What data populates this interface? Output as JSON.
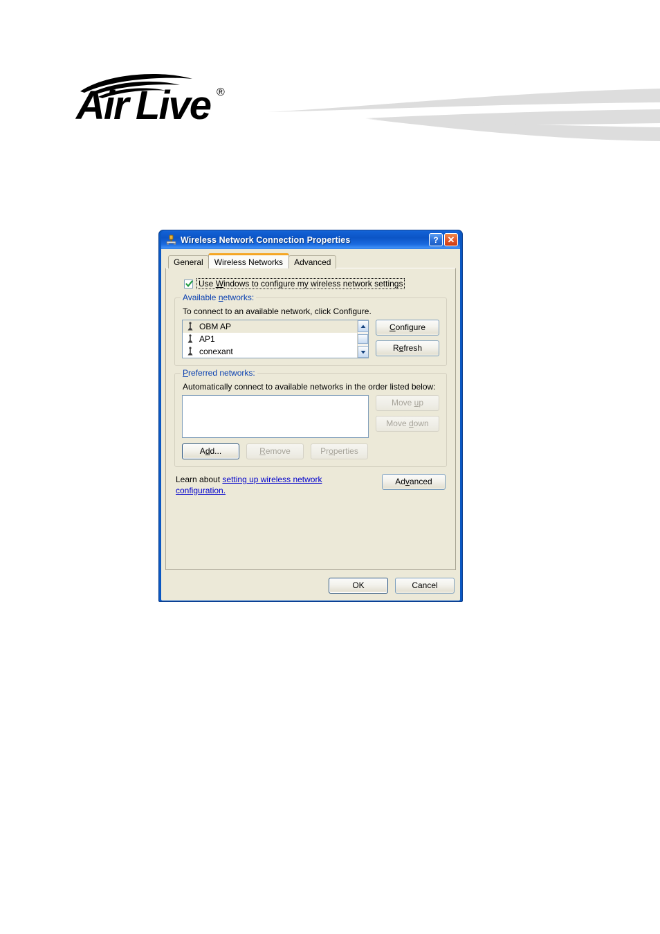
{
  "branding": {
    "logo_text": "Air Live",
    "logo_trademark": "®",
    "swoosh": "decorative-swoosh"
  },
  "dialog": {
    "title": "Wireless Network Connection Properties",
    "titlebar_icon": "network-connection-icon",
    "help_button": "?",
    "close_button": "✕",
    "tabs": [
      {
        "label": "General",
        "active": false
      },
      {
        "label": "Wireless Networks",
        "active": true
      },
      {
        "label": "Advanced",
        "active": false
      }
    ],
    "use_windows_checkbox": {
      "checked": true,
      "label_pre": "U",
      "label_accel": "W",
      "label_full": "Use Windows to configure my wireless network settings",
      "part1": "Use ",
      "part2": "indows to configure my wireless network settings"
    },
    "available_networks": {
      "title_part1": "Available ",
      "title_accel": "n",
      "title_part2": "etworks:",
      "hint": "To connect to an available network, click Configure.",
      "items": [
        {
          "name": "OBM AP",
          "icon": "wireless-network-icon",
          "selected": true
        },
        {
          "name": "AP1",
          "icon": "wireless-network-icon",
          "selected": false
        },
        {
          "name": "conexant",
          "icon": "wireless-network-icon",
          "selected": false
        }
      ],
      "configure_button": {
        "pre": "",
        "accel": "C",
        "post": "onfigure",
        "enabled": true
      },
      "refresh_button": {
        "pre": "R",
        "accel": "e",
        "post": "fresh",
        "enabled": true
      }
    },
    "preferred_networks": {
      "title_accel": "P",
      "title_post": "referred networks:",
      "hint": "Automatically connect to available networks in the order listed below:",
      "items": [],
      "move_up_button": {
        "pre": "Move ",
        "accel": "u",
        "post": "p",
        "enabled": false
      },
      "move_down_button": {
        "pre": "Move ",
        "accel": "d",
        "post": "own",
        "enabled": false
      },
      "add_button": {
        "pre": "A",
        "accel": "d",
        "post": "d...",
        "enabled": true
      },
      "remove_button": {
        "pre": "",
        "accel": "R",
        "post": "emove",
        "enabled": false
      },
      "properties_button": {
        "pre": "Pr",
        "accel": "o",
        "post": "perties",
        "enabled": false
      }
    },
    "learn_about": {
      "prefix": "Learn about ",
      "link_text": "setting up wireless network configuration."
    },
    "advanced_button": {
      "pre": "Ad",
      "accel": "v",
      "post": "anced",
      "enabled": true
    },
    "ok_button": "OK",
    "cancel_button": "Cancel"
  },
  "colors": {
    "titlebar_blue": "#0c55c6",
    "dialog_face": "#ece9d8",
    "group_label_blue": "#0a40b0",
    "link_blue": "#0000cc",
    "active_tab_orange": "#f5a623",
    "close_button_orange": "#e2552a",
    "swoosh_gray": "#dddddd"
  }
}
